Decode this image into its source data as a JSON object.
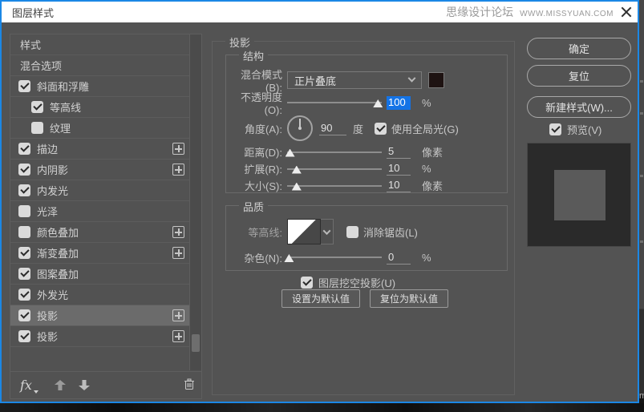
{
  "window": {
    "title": "图层样式",
    "watermark_cn": "思缘设计论坛",
    "watermark_url": "WWW.MISSYUAN.COM"
  },
  "sidebar": {
    "items": [
      {
        "label": "样式"
      },
      {
        "label": "混合选项"
      },
      {
        "label": "斜面和浮雕",
        "checked": true
      },
      {
        "label": "等高线",
        "checked": true,
        "indent": true
      },
      {
        "label": "纹理",
        "checked": false,
        "indent": true
      },
      {
        "label": "描边",
        "checked": true,
        "plus": true
      },
      {
        "label": "内阴影",
        "checked": true,
        "plus": true
      },
      {
        "label": "内发光",
        "checked": true
      },
      {
        "label": "光泽",
        "checked": false
      },
      {
        "label": "颜色叠加",
        "checked": false,
        "plus": true
      },
      {
        "label": "渐变叠加",
        "checked": true,
        "plus": true
      },
      {
        "label": "图案叠加",
        "checked": true
      },
      {
        "label": "外发光",
        "checked": true
      },
      {
        "label": "投影",
        "checked": true,
        "plus": true,
        "selected": true
      },
      {
        "label": "投影",
        "checked": true,
        "plus": true
      }
    ],
    "fx_label": "fx"
  },
  "panel": {
    "title": "投影",
    "structure": {
      "legend": "结构",
      "blend_mode": {
        "label": "混合模式(B):",
        "value": "正片叠底",
        "swatch_color": "#1e1312"
      },
      "opacity": {
        "label": "不透明度(O):",
        "value": "100",
        "unit": "%",
        "percent": 96
      },
      "angle": {
        "label": "角度(A):",
        "value": "90",
        "unit": "度",
        "global_light_label": "使用全局光(G)",
        "global_light_checked": true
      },
      "distance": {
        "label": "距离(D):",
        "value": "5",
        "unit": "像素",
        "percent": 3
      },
      "spread": {
        "label": "扩展(R):",
        "value": "10",
        "unit": "%",
        "percent": 10
      },
      "size": {
        "label": "大小(S):",
        "value": "10",
        "unit": "像素",
        "percent": 10
      }
    },
    "quality": {
      "legend": "品质",
      "contour": {
        "label": "等高线:",
        "anti_alias_label": "消除锯齿(L)",
        "anti_alias_checked": false
      },
      "noise": {
        "label": "杂色(N):",
        "value": "0",
        "unit": "%",
        "percent": 2
      }
    },
    "knockout": {
      "label": "图层挖空投影(U)",
      "checked": true
    },
    "default_buttons": {
      "make_default": "设置为默认值",
      "reset_default": "复位为默认值"
    }
  },
  "actions": {
    "ok": "确定",
    "reset": "复位",
    "new_style": "新建样式(W)...",
    "preview": {
      "label": "预览(V)",
      "checked": true
    }
  },
  "colors": {
    "accent": "#1473e6",
    "window_border": "#1b87e5",
    "dialog_bg": "#535353",
    "shadow_swatch": "#1e1312"
  }
}
